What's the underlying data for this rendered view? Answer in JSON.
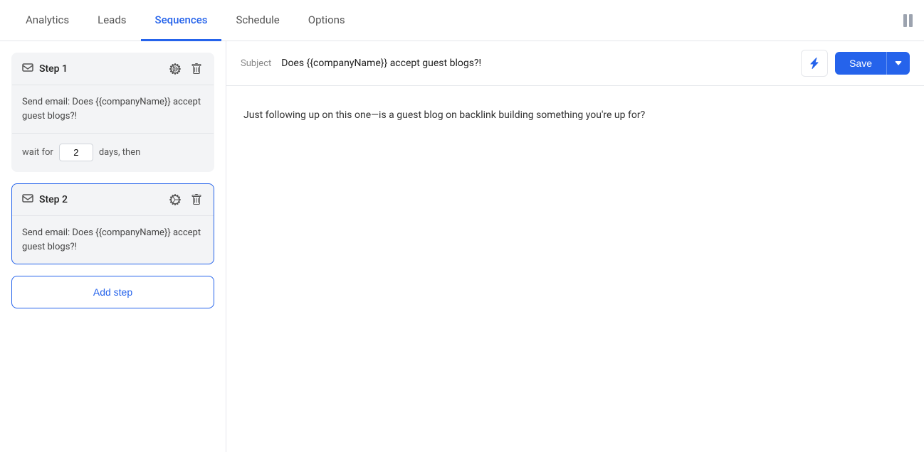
{
  "nav": {
    "tabs": [
      {
        "id": "analytics",
        "label": "Analytics",
        "active": false
      },
      {
        "id": "leads",
        "label": "Leads",
        "active": false
      },
      {
        "id": "sequences",
        "label": "Sequences",
        "active": true
      },
      {
        "id": "schedule",
        "label": "Schedule",
        "active": false
      },
      {
        "id": "options",
        "label": "Options",
        "active": false
      }
    ]
  },
  "steps": [
    {
      "id": "step1",
      "title": "Step 1",
      "emailDesc": "Send email: Does {{companyName}} accept guest blogs?!",
      "waitDays": "2",
      "selected": false
    },
    {
      "id": "step2",
      "title": "Step 2",
      "emailDesc": "Send email: Does {{companyName}} accept guest blogs?!",
      "waitDays": "",
      "selected": true
    }
  ],
  "addStepLabel": "Add step",
  "email": {
    "subjectLabel": "Subject",
    "subjectValue": "Does {{companyName}} accept guest blogs?!",
    "bodyText": "Just following up on this one—is a guest blog on backlink building something you're up for?",
    "saveLabel": "Save"
  },
  "waitLabel": "wait for",
  "daysThenLabel": "days, then"
}
